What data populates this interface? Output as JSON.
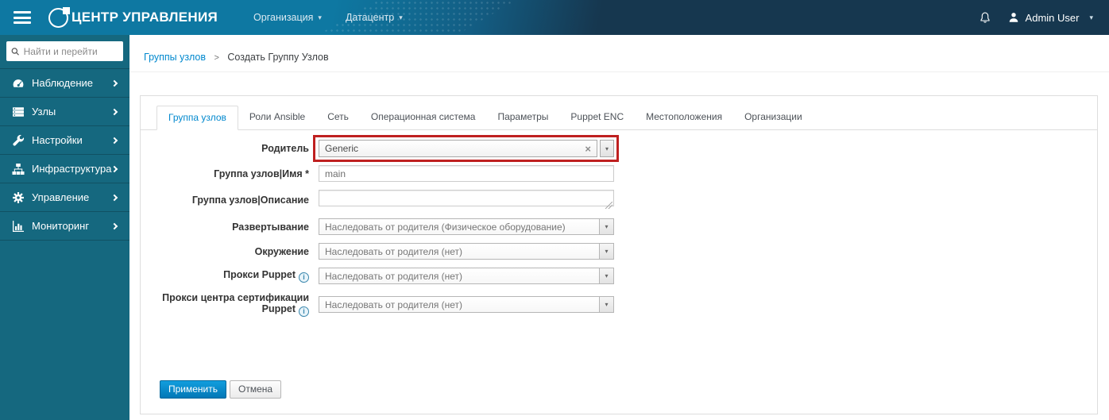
{
  "topbar": {
    "brand": "ЦЕНТР УПРАВЛЕНИЯ",
    "menus": {
      "organization": "Организация",
      "location": "Датацентр"
    },
    "user": {
      "name": "Admin User"
    }
  },
  "sidebar": {
    "search_placeholder": "Найти и перейти",
    "items": [
      {
        "label": "Наблюдение"
      },
      {
        "label": "Узлы"
      },
      {
        "label": "Настройки"
      },
      {
        "label": "Инфраструктура"
      },
      {
        "label": "Управление"
      },
      {
        "label": "Мониторинг"
      }
    ]
  },
  "breadcrumb": {
    "link": "Группы узлов",
    "separator": ">",
    "current": "Создать Группу Узлов"
  },
  "tabs": [
    "Группа узлов",
    "Роли Ansible",
    "Сеть",
    "Операционная система",
    "Параметры",
    "Puppet ENC",
    "Местоположения",
    "Организации"
  ],
  "form": {
    "parent": {
      "label": "Родитель",
      "value": "Generic"
    },
    "name": {
      "label": "Группа узлов|Имя *",
      "value": "main"
    },
    "description": {
      "label": "Группа узлов|Описание",
      "value": ""
    },
    "deployment": {
      "label": "Развертывание",
      "value": "Наследовать от родителя (Физическое оборудование)"
    },
    "environment": {
      "label": "Окружение",
      "value": "Наследовать от родителя (нет)"
    },
    "puppet_proxy": {
      "label": "Прокси Puppet",
      "value": "Наследовать от родителя (нет)"
    },
    "puppet_ca_proxy": {
      "label": "Прокси центра сертификации Puppet",
      "value": "Наследовать от родителя (нет)"
    }
  },
  "actions": {
    "submit": "Применить",
    "cancel": "Отмена"
  },
  "icons": {
    "caret_down": "▾",
    "close": "×",
    "info": "i"
  },
  "colors": {
    "accent": "#0088ce",
    "topbar_teal": "#0e78a2",
    "topbar_navy": "#16374f",
    "sidebar_teal": "#15687f",
    "highlight_red": "#bf2020"
  }
}
